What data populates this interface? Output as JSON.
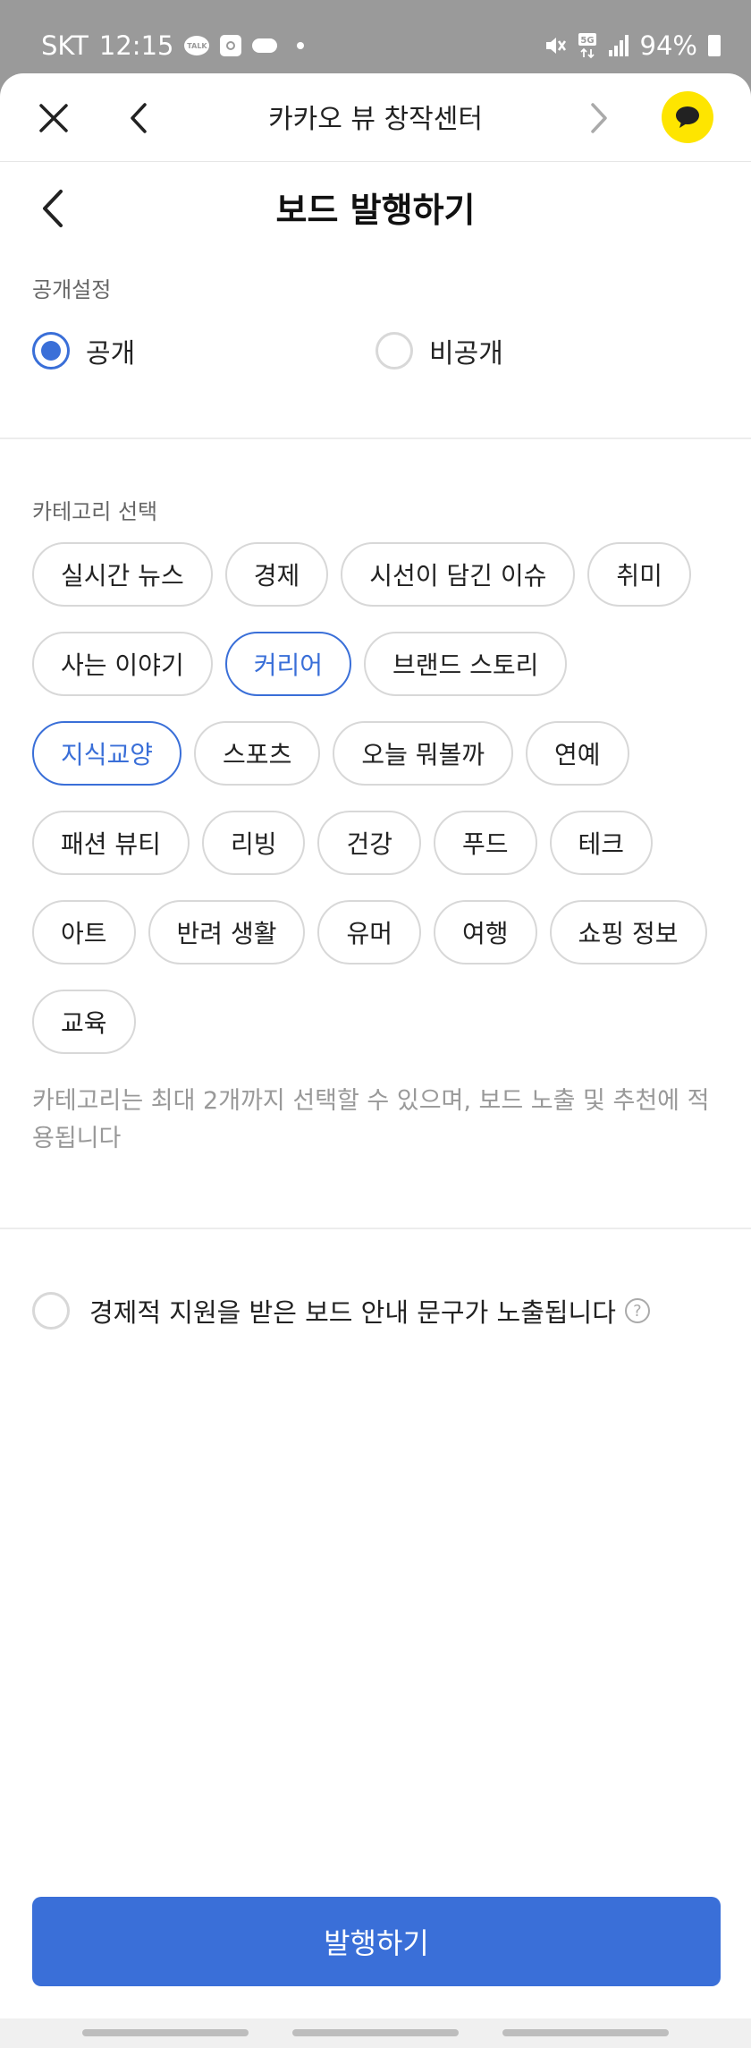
{
  "status_bar": {
    "carrier": "SKT",
    "time": "12:15",
    "battery": "94%",
    "notif_icons": [
      "kakaotalk-icon",
      "camera-icon",
      "cloud-icon",
      "dot-icon"
    ],
    "status_icons": [
      "mute-icon",
      "5g-icon",
      "signal-icon",
      "battery-icon"
    ]
  },
  "webview": {
    "title": "카카오 뷰 창작센터"
  },
  "page": {
    "title": "보드 발행하기"
  },
  "visibility": {
    "label": "공개설정",
    "options": [
      {
        "label": "공개",
        "selected": true
      },
      {
        "label": "비공개",
        "selected": false
      }
    ]
  },
  "category": {
    "label": "카테고리 선택",
    "rows": [
      [
        {
          "label": "실시간 뉴스",
          "selected": false
        },
        {
          "label": "경제",
          "selected": false
        },
        {
          "label": "시선이 담긴 이슈",
          "selected": false
        },
        {
          "label": "취미",
          "selected": false
        }
      ],
      [
        {
          "label": "사는 이야기",
          "selected": false
        },
        {
          "label": "커리어",
          "selected": true
        },
        {
          "label": "브랜드 스토리",
          "selected": false
        }
      ],
      [
        {
          "label": "지식교양",
          "selected": true
        },
        {
          "label": "스포츠",
          "selected": false
        },
        {
          "label": "오늘 뭐볼까",
          "selected": false
        },
        {
          "label": "연예",
          "selected": false
        }
      ],
      [
        {
          "label": "패션 뷰티",
          "selected": false
        },
        {
          "label": "리빙",
          "selected": false
        },
        {
          "label": "건강",
          "selected": false
        },
        {
          "label": "푸드",
          "selected": false
        },
        {
          "label": "테크",
          "selected": false
        }
      ],
      [
        {
          "label": "아트",
          "selected": false
        },
        {
          "label": "반려 생활",
          "selected": false
        },
        {
          "label": "유머",
          "selected": false
        },
        {
          "label": "여행",
          "selected": false
        },
        {
          "label": "쇼핑 정보",
          "selected": false
        }
      ],
      [
        {
          "label": "교육",
          "selected": false
        }
      ]
    ],
    "help": "카테고리는 최대 2개까지 선택할 수 있으며, 보드 노출 및 추천에 적용됩니다"
  },
  "sponsor": {
    "label": "경제적 지원을 받은 보드 안내 문구가 노출됩니다",
    "checked": false,
    "help_icon": "?"
  },
  "actions": {
    "publish_label": "발행하기"
  },
  "colors": {
    "accent": "#3a6fd8",
    "kakao_yellow": "#fee500",
    "status_bar_bg": "#9a9a9a"
  }
}
